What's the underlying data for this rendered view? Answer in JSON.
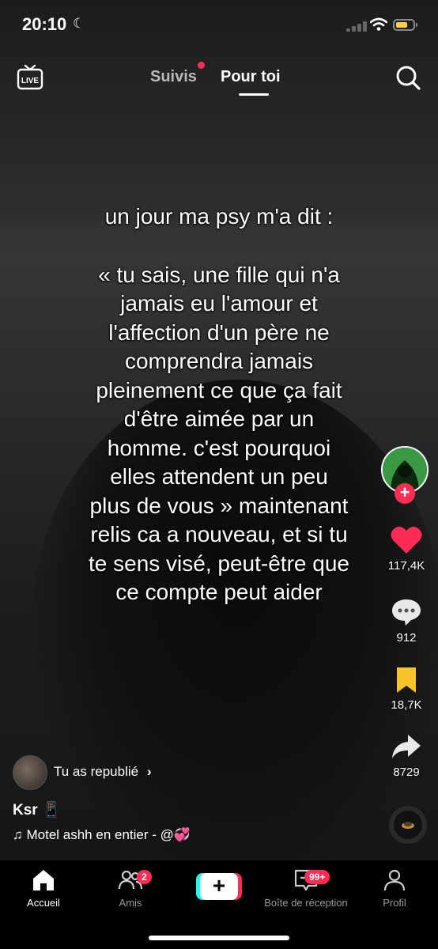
{
  "status_bar": {
    "time": "20:10"
  },
  "top_nav": {
    "tab_following": "Suivis",
    "tab_for_you": "Pour toi",
    "live_label": "LIVE"
  },
  "caption": {
    "line1": "un jour ma psy m'a dit :",
    "body": [
      "« tu sais, une fille qui n'a",
      "jamais eu l'amour et",
      "l'affection d'un père ne",
      "comprendra jamais",
      "pleinement ce que ça fait",
      "d'être aimée par un",
      "homme. c'est pourquoi",
      "elles attendent un peu",
      "plus de vous » maintenant",
      "relis ca a nouveau, et si tu",
      "te sens visé, peut-être que",
      "ce compte peut aider"
    ]
  },
  "actions": {
    "likes": "117,4K",
    "comments": "912",
    "bookmarks": "18,7K",
    "shares": "8729",
    "follow_symbol": "+"
  },
  "post_info": {
    "repost_text": "Tu as republié",
    "username": "Ksr 📱",
    "music": "Motel ashh en entier - @💞"
  },
  "bottom_nav": {
    "home": "Accueil",
    "friends": "Amis",
    "friends_badge": "2",
    "create": "+",
    "inbox": "Boîte de réception",
    "inbox_badge": "99+",
    "profile": "Profil"
  },
  "colors": {
    "accent": "#fe2c55",
    "bookmark": "#f7c52b",
    "cyan": "#25f4ee"
  }
}
